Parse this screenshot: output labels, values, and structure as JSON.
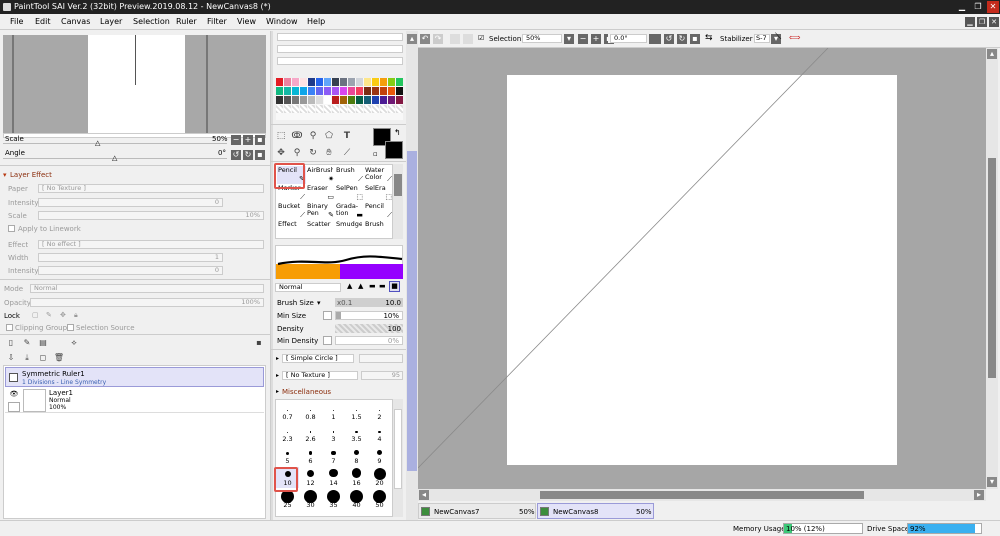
{
  "window": {
    "title": "PaintTool SAI Ver.2 (32bit) Preview.2019.08.12 - NewCanvas8 (*)"
  },
  "menu": [
    "File",
    "Edit",
    "Canvas",
    "Layer",
    "Selection",
    "Ruler",
    "Filter",
    "View",
    "Window",
    "Help"
  ],
  "navigator": {
    "scale_label": "Scale",
    "scale_value": "50%",
    "angle_label": "Angle",
    "angle_value": "0°"
  },
  "layer_effect": {
    "header": "Layer Effect",
    "paper_label": "Paper",
    "paper_value": "[ No Texture ]",
    "intensity_label": "Intensity",
    "intensity_value": "0",
    "scale_label": "Scale",
    "scale_value": "10%",
    "apply_linework": "Apply to Linework",
    "effect_label": "Effect",
    "effect_value": "[ No effect ]",
    "width_label": "Width",
    "width_value": "1",
    "effect_intensity_label": "Intensity",
    "effect_intensity_value": "0"
  },
  "layer_props": {
    "mode_label": "Mode",
    "mode_value": "Normal",
    "opacity_label": "Opacity",
    "opacity_value": "100%",
    "lock_label": "Lock",
    "clipping_group": "Clipping Group",
    "selection_source": "Selection Source"
  },
  "layers": [
    {
      "name": "Symmetric Ruler1",
      "sub": "1 Divisions - Line Symmetry",
      "selected": true
    },
    {
      "name": "Layer1",
      "mode": "Normal",
      "opacity": "100%",
      "selected": false
    }
  ],
  "palette_colors": [
    "#e31b23",
    "#ee82a0",
    "#f6a8c8",
    "#fde2e4",
    "#1e3a8a",
    "#2563eb",
    "#60a5fa",
    "#374151",
    "#6b7280",
    "#9ca3af",
    "#d1d5db",
    "#fde68a",
    "#facc15",
    "#f59e0b",
    "#84cc16",
    "#22c55e",
    "#10b981",
    "#14b8a6",
    "#06b6d4",
    "#0ea5e9",
    "#3b82f6",
    "#6366f1",
    "#8b5cf6",
    "#a855f7",
    "#d946ef",
    "#ec4899",
    "#f43f5e",
    "#7c2d12",
    "#9a3412",
    "#c2410c",
    "#ea580c",
    "#111111",
    "#333333",
    "#555555",
    "#777777",
    "#999999",
    "#bbbbbb",
    "#dddddd",
    "#ffffff",
    "#b91c1c",
    "#a16207",
    "#4d7c0f",
    "#065f46",
    "#155e75",
    "#1e40af",
    "#4c1d95",
    "#701a75",
    "#831843"
  ],
  "brushes": [
    {
      "name": "Pencil"
    },
    {
      "name": "AirBrush"
    },
    {
      "name": "Brush"
    },
    {
      "name": "Water Color"
    },
    {
      "name": "Marker"
    },
    {
      "name": "Eraser"
    },
    {
      "name": "SelPen"
    },
    {
      "name": "SelEra"
    },
    {
      "name": "Bucket"
    },
    {
      "name": "Binary Pen"
    },
    {
      "name": "Grada- tion"
    },
    {
      "name": "Pencil"
    },
    {
      "name": "Effect"
    },
    {
      "name": "Scatter"
    },
    {
      "name": "Smudge"
    },
    {
      "name": "Brush"
    }
  ],
  "brush_settings": {
    "mode": "Normal",
    "brush_size_label": "Brush Size",
    "brush_size_mult": "x0.1",
    "brush_size_value": "10.0",
    "min_size_label": "Min Size",
    "min_size_value": "10%",
    "density_label": "Density",
    "density_value": "100",
    "min_density_label": "Min Density",
    "min_density_value": "0%",
    "shape": "[ Simple Circle ]",
    "texture": "[ No Texture ]",
    "texture_val": "95",
    "misc": "Miscellaneous"
  },
  "brush_sizes": [
    "0.7",
    "0.8",
    "1",
    "1.5",
    "2",
    "2.3",
    "2.6",
    "3",
    "3.5",
    "4",
    "5",
    "6",
    "7",
    "8",
    "9",
    "10",
    "12",
    "14",
    "16",
    "20",
    "25",
    "30",
    "35",
    "40",
    "50"
  ],
  "toolbar": {
    "selection_label": "Selection",
    "zoom": "50%",
    "angle": "0.0°",
    "stabilizer_label": "Stabilizer",
    "stabilizer_value": "S-7"
  },
  "tabs": [
    {
      "name": "NewCanvas7",
      "zoom": "50%",
      "active": false
    },
    {
      "name": "NewCanvas8",
      "zoom": "50%",
      "active": true
    }
  ],
  "status": {
    "memory_label": "Memory Usage",
    "memory_value": "10% (12%)",
    "memory_fraction": 0.1,
    "drive_label": "Drive Space",
    "drive_value": "92%",
    "drive_fraction": 0.92
  }
}
